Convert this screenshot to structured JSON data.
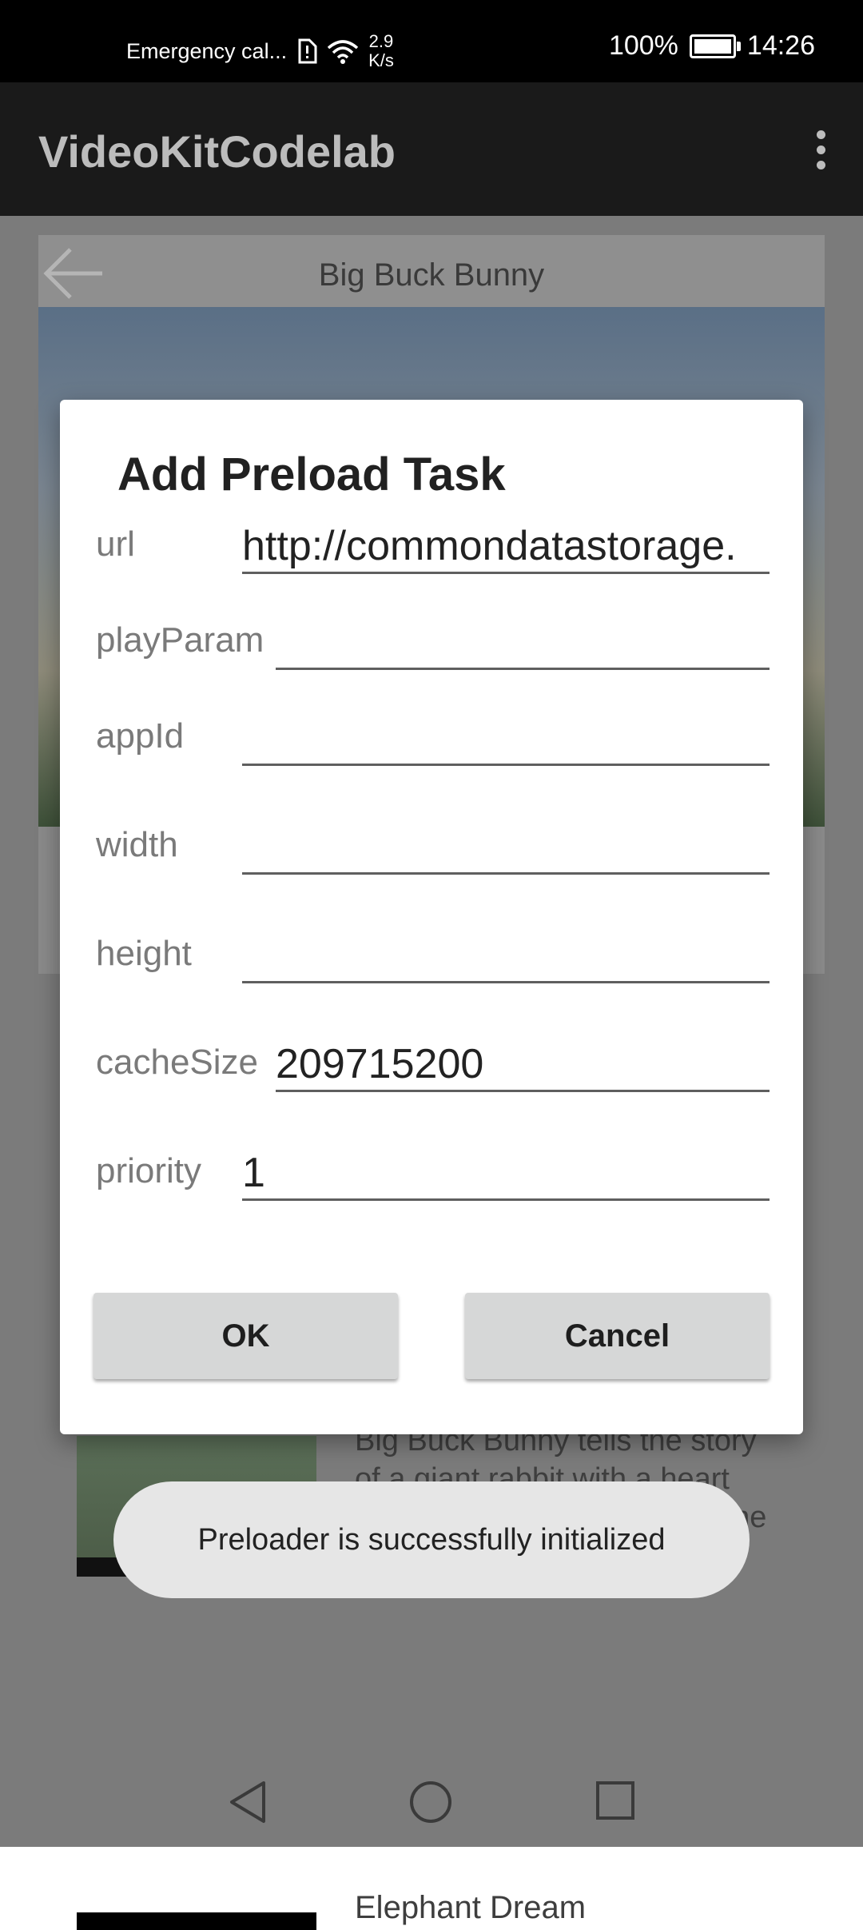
{
  "status_bar": {
    "carrier": "Emergency cal...",
    "speed_value": "2.9",
    "speed_unit": "K/s",
    "battery": "100%",
    "time": "14:26"
  },
  "app_bar": {
    "title": "VideoKitCodelab",
    "menu_icon": "more-vert-icon"
  },
  "player": {
    "video_title": "Big Buck Bunny",
    "back_icon": "arrow-left-icon"
  },
  "list": {
    "item1_description": "Big Buck Bunny tells the story of a giant rabbit with a heart bigger than himself. When one sunny day three",
    "item2_title": "Elephant Dream"
  },
  "dialog": {
    "title": "Add Preload Task",
    "fields": [
      {
        "label": "url",
        "value": "http://commondatastorage."
      },
      {
        "label": "playParam",
        "value": ""
      },
      {
        "label": "appId",
        "value": ""
      },
      {
        "label": "width",
        "value": ""
      },
      {
        "label": "height",
        "value": ""
      },
      {
        "label": "cacheSize",
        "value": "209715200"
      },
      {
        "label": "priority",
        "value": "1"
      }
    ],
    "ok_label": "OK",
    "cancel_label": "Cancel"
  },
  "toast": {
    "message": "Preloader is successfully initialized"
  },
  "nav": {
    "back_icon": "nav-back-icon",
    "home_icon": "nav-home-icon",
    "recents_icon": "nav-recents-icon"
  }
}
